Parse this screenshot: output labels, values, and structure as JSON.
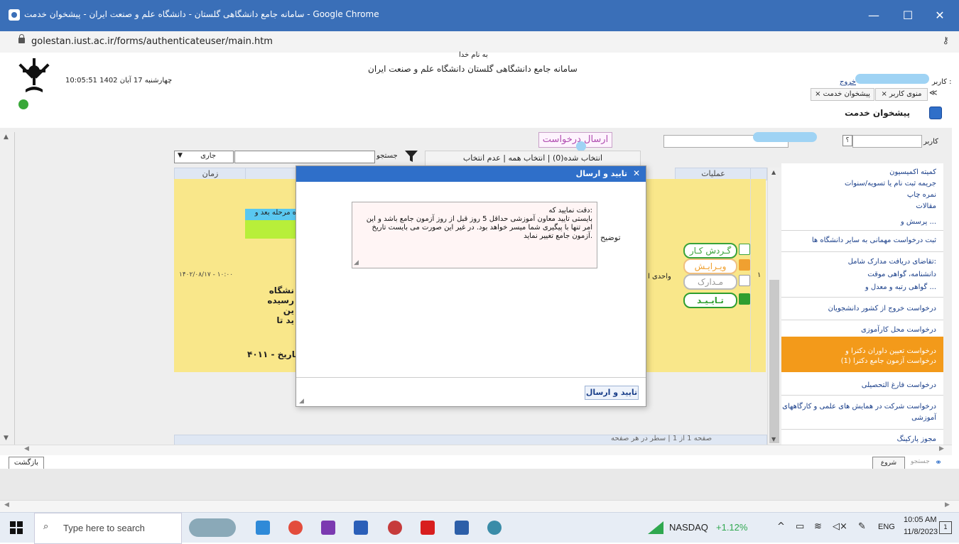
{
  "window": {
    "title": "سامانه جامع دانشگاهی گلستان - دانشگاه علم و صنعت ایران - پیشخوان خدمت - Google Chrome",
    "minimize": "—",
    "maximize": "☐",
    "close": "✕"
  },
  "address_bar": {
    "url": "golestan.iust.ac.ir/forms/authenticateuser/main.htm"
  },
  "header": {
    "bismillah": "به نام خدا",
    "system_name": "سامانه جامع دانشگاهی گلستان   دانشگاه علم و صنعت ایران",
    "datetime": "10:05:51 چهارشنبه 17 آبان 1402",
    "user_label": "کاربر :",
    "logout": "خروج",
    "tab_user_menu": "منوی کاربر",
    "tab_service_desk": "پیشخوان خدمت",
    "tab_close": "×",
    "collapse": "≪",
    "page_title": "پیشخوان خدمت"
  },
  "toolbar": {
    "send_request": "ارسال درخواست",
    "user_label": "کاربر",
    "help_icon": "؟",
    "selected_count": "انتخاب شده(0) | انتخاب همه | عدم انتخاب",
    "search_label": "جستجو",
    "status_select": "جاری"
  },
  "table": {
    "col_ops": "عملیات",
    "col_time": "زمان",
    "time_value": "۱۴۰۲/۰۸/۱۷ - ۱۰:۰۰",
    "row_index": "۱",
    "unit_label": "واحدی ا",
    "stage_label": "ه مرحله بعد و",
    "body_lines": [
      "نشگاه رسیده",
      "ین",
      "ید تا"
    ],
    "footer_date": "۴۰۱۱ - تاریخ",
    "pagination": "صفحه  1  از 1   |   سطر در هر صفحه"
  },
  "actions": {
    "workflow": "گـردش کـار",
    "edit": "ویـرایـش",
    "documents": "مـدارک",
    "approve": "تـایـیـد"
  },
  "sidebar": {
    "items": [
      "کمیته اکمیسیون",
      "جریمه ثبت نام یا تسویه/سنوات",
      "نمره چاپ",
      "مقالات",
      "پرسش و ...",
      "ثبت درخواست مهمانی به سایر دانشگاه ها",
      "تقاضای دریافت مدارک شامل:",
      "دانشنامه، گواهی موقت",
      "گواهی رتبه و معدل و ...",
      "درخواست خروج از کشور دانشجویان",
      "درخواست محل کارآموزی",
      "درخواست تعیین داوران دکترا و",
      "درخواست آزمون جامع دکترا (1)",
      "درخواست فارغ التحصیلی",
      "درخواست شرکت در همایش های علمی و کارگاههای",
      "آموزشی",
      "مجوز پارکینگ"
    ]
  },
  "modal": {
    "title": "تایید و ارسال",
    "description_label": "توضیح",
    "message": [
      "دقت نمایید که:",
      "بایستی تایید معاون آموزشی حداقل 5 روز قبل از روز آزمون جامع باشد و این",
      "امر تنها با پیگیری شما میسر خواهد بود. در غیر این صورت می بایست تاریخ",
      "آزمون جامع تغییر نماید."
    ],
    "confirm_button": "تایید و ارسال"
  },
  "bottom": {
    "back": "بازگشت",
    "start_again": "شروع مجدد",
    "search_small": "جستجو"
  },
  "taskbar": {
    "search_placeholder": "Type here to search",
    "ticker": "NASDAQ",
    "ticker_change": "+1.12%",
    "lang": "ENG",
    "time": "10:05 AM",
    "date": "11/8/2023",
    "notif_count": "1"
  },
  "colors": {
    "titlebar": "#3a6fb8",
    "modal_header": "#2f6fc9",
    "row_yellow": "#f9e78a",
    "sidebar_highlight": "#f39a1a",
    "approve_green": "#2f9e2f",
    "workflow_green": "#3aa33a",
    "edit_orange": "#f0a030",
    "docs_gray": "#999999",
    "ticker_green": "#2fa84f"
  }
}
